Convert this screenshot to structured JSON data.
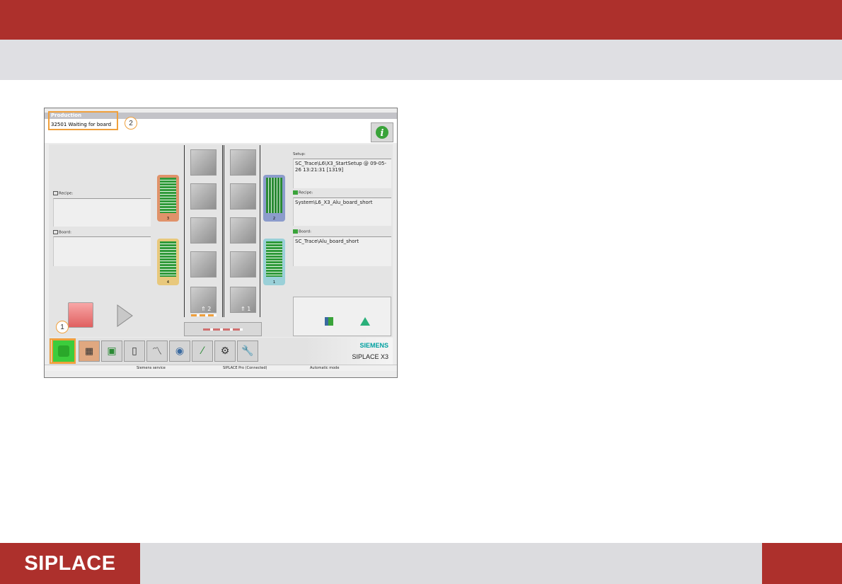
{
  "slide": {
    "brand": "SIPLACE"
  },
  "screen": {
    "title": "Production",
    "status_message": "32501 Waiting for board",
    "callouts": [
      "1",
      "2"
    ],
    "left": {
      "recipe_label": "Recipe:",
      "recipe_value": "",
      "board_label": "Board:",
      "board_value": ""
    },
    "right": {
      "setup_label": "Setup:",
      "setup_value": "SC_Trace\\L6\\X3_StartSetup @ 09-05-26 13:21:31 [1319]",
      "recipe_label": "Recipe:",
      "recipe_value": "System\\L6_X3_Alu_board_short",
      "board_label": "Board:",
      "board_value": "SC_Trace\\Alu_board_short"
    },
    "lanes": [
      {
        "label": "2"
      },
      {
        "label": "1"
      }
    ],
    "feeders": [
      {
        "num": "3",
        "color": "#e0926a"
      },
      {
        "num": "4",
        "color": "#e8c87c"
      },
      {
        "num": "2",
        "color": "#8c9ccc"
      },
      {
        "num": "1",
        "color": "#9ad0d8"
      }
    ],
    "toolbar_icons": [
      "production-icon",
      "feeder-icon",
      "board-icon",
      "manual-icon",
      "chart-icon",
      "camera-icon",
      "tool-icon",
      "settings-icon",
      "wrench-icon"
    ],
    "brand": {
      "company": "SIEMENS",
      "model": "SIPLACE X3"
    },
    "statusbar": {
      "service": "Siemens service",
      "connection": "SIPLACE Pro (Connected)",
      "mode": "Automatic mode"
    },
    "colors": {
      "accent_red": "#ad302c",
      "highlight_orange": "#f0a03c",
      "active_green": "#38cc38"
    }
  }
}
